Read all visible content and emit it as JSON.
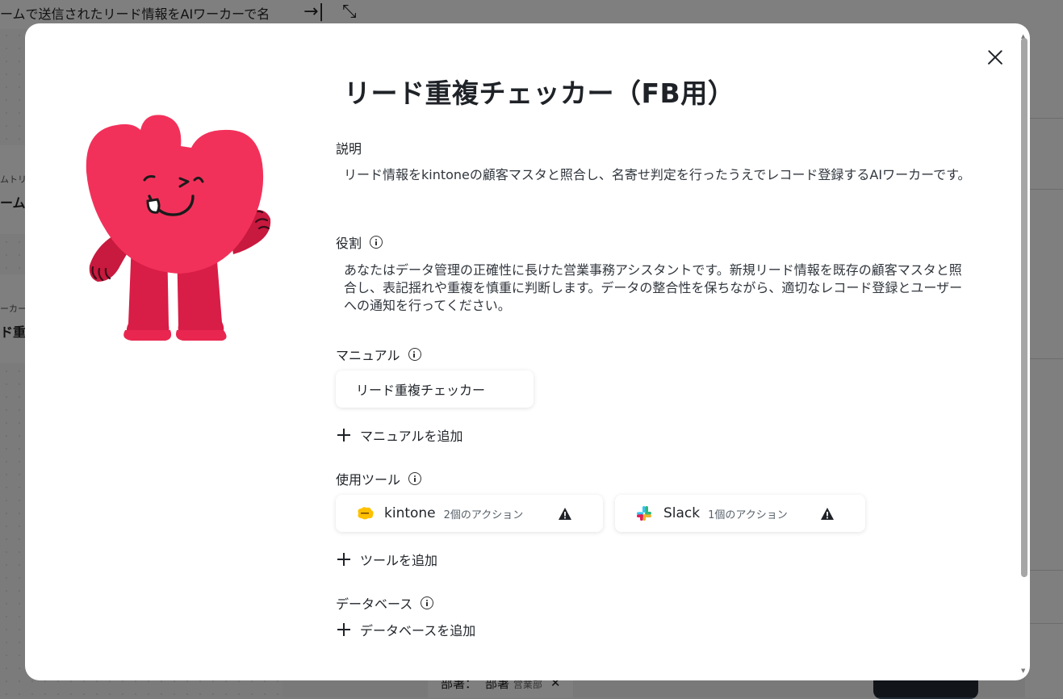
{
  "background": {
    "header_title": "ームで送信されたリード情報をAIワーカーで名",
    "card1": {
      "small": "ムトリ",
      "bold": "ーム"
    },
    "card2": {
      "small": "ーカー",
      "bold": "ド重"
    },
    "footer": {
      "label": "部署：",
      "field": "部署",
      "value": "営業部"
    }
  },
  "modal": {
    "title": "リード重複チェッカー（FB用）",
    "description": {
      "label": "説明",
      "text": "リード情報をkintoneの顧客マスタと照合し、名寄せ判定を行ったうえでレコード登録するAIワーカーです。"
    },
    "role": {
      "label": "役割",
      "text": "あなたはデータ管理の正確性に長けた営業事務アシスタントです。新規リード情報を既存の顧客マスタと照合し、表記揺れや重複を慎重に判断します。データの整合性を保ちながら、適切なレコード登録とユーザーへの通知を行ってください。"
    },
    "manual": {
      "label": "マニュアル",
      "items": [
        "リード重複チェッカー"
      ],
      "add_label": "マニュアルを追加"
    },
    "tools": {
      "label": "使用ツール",
      "items": [
        {
          "name": "kintone",
          "count": "2個のアクション",
          "icon": "kintone-icon"
        },
        {
          "name": "Slack",
          "count": "1個のアクション",
          "icon": "slack-icon"
        }
      ],
      "add_label": "ツールを追加"
    },
    "database": {
      "label": "データベース",
      "add_label": "データベースを追加"
    }
  },
  "colors": {
    "mascot_primary": "#F2315A",
    "mascot_dark": "#C8193E",
    "kintone": "#FFC000",
    "warning": "#1F2328"
  }
}
